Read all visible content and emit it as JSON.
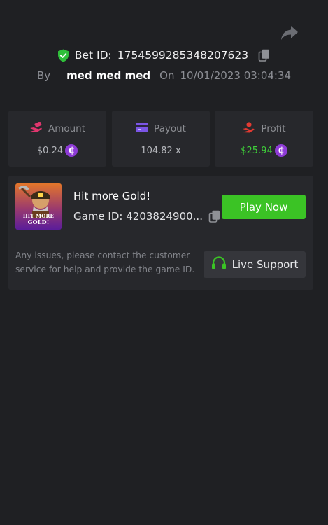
{
  "header": {
    "bet_id_label": "Bet ID:",
    "bet_id": "1754599285348207623",
    "by_label": "By",
    "username": "med med med",
    "on_label": "On",
    "datetime": "10/01/2023 03:04:34"
  },
  "stats": {
    "amount": {
      "label": "Amount",
      "value": "$0.24",
      "icon": "hand-money-icon"
    },
    "payout": {
      "label": "Payout",
      "value": "104.82 x",
      "icon": "card-icon"
    },
    "profit": {
      "label": "Profit",
      "value": "$25.94",
      "icon": "profit-hand-icon"
    },
    "currency_symbol": "₵"
  },
  "game": {
    "title": "Hit more Gold!",
    "id_label": "Game ID:",
    "id_value": "4203824900...",
    "thumb_line1": "HIT MORE",
    "thumb_line2": "GOLD!",
    "play_label": "Play Now"
  },
  "support": {
    "note": "Any issues, please contact the customer service for help and provide the game ID.",
    "button_label": "Live Support"
  },
  "colors": {
    "background": "#1f2023",
    "card": "#27282c",
    "accent_green": "#3bc325",
    "coin_purple": "#8e3bd6",
    "amount_icon": "#e0366e",
    "payout_icon": "#7b55e6",
    "profit_icon": "#e23a32"
  }
}
